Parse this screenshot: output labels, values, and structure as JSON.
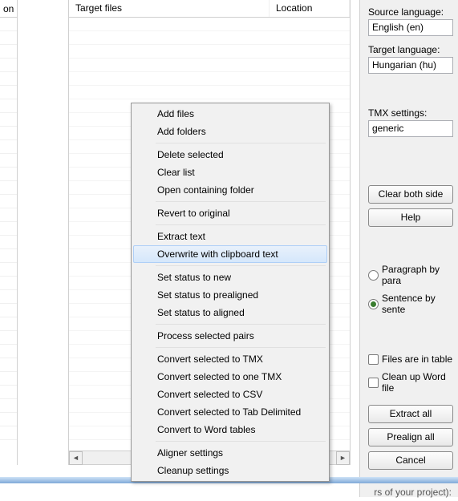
{
  "left_panel": {
    "header": "on"
  },
  "mid_panel": {
    "col_target": "Target files",
    "col_location": "Location"
  },
  "right_panel": {
    "source_lang_label": "Source language:",
    "source_lang_value": "English (en)",
    "target_lang_label": "Target language:",
    "target_lang_value": "Hungarian (hu)",
    "tmx_label": "TMX settings:",
    "tmx_value": "generic",
    "btn_clear": "Clear both side",
    "btn_help": "Help",
    "radio_para": "Paragraph by para",
    "radio_sent": "Sentence by sente",
    "check_table": "Files are in table",
    "check_clean": "Clean up Word file",
    "btn_extract": "Extract all",
    "btn_prealign": "Prealign all",
    "btn_cancel": "Cancel"
  },
  "menu": {
    "add_files": "Add files",
    "add_folders": "Add folders",
    "delete_sel": "Delete selected",
    "clear_list": "Clear list",
    "open_folder": "Open containing folder",
    "revert": "Revert to original",
    "extract": "Extract text",
    "overwrite": "Overwrite with clipboard text",
    "status_new": "Set status to new",
    "status_pre": "Set status to prealigned",
    "status_al": "Set status to aligned",
    "process": "Process selected pairs",
    "conv_tmx": "Convert selected to TMX",
    "conv_one": "Convert selected to one TMX",
    "conv_csv": "Convert selected to CSV",
    "conv_tab": "Convert selected to Tab Delimited",
    "conv_word": "Convert to Word tables",
    "aligner": "Aligner settings",
    "cleanup": "Cleanup settings"
  },
  "bottom": "rs of your project):"
}
